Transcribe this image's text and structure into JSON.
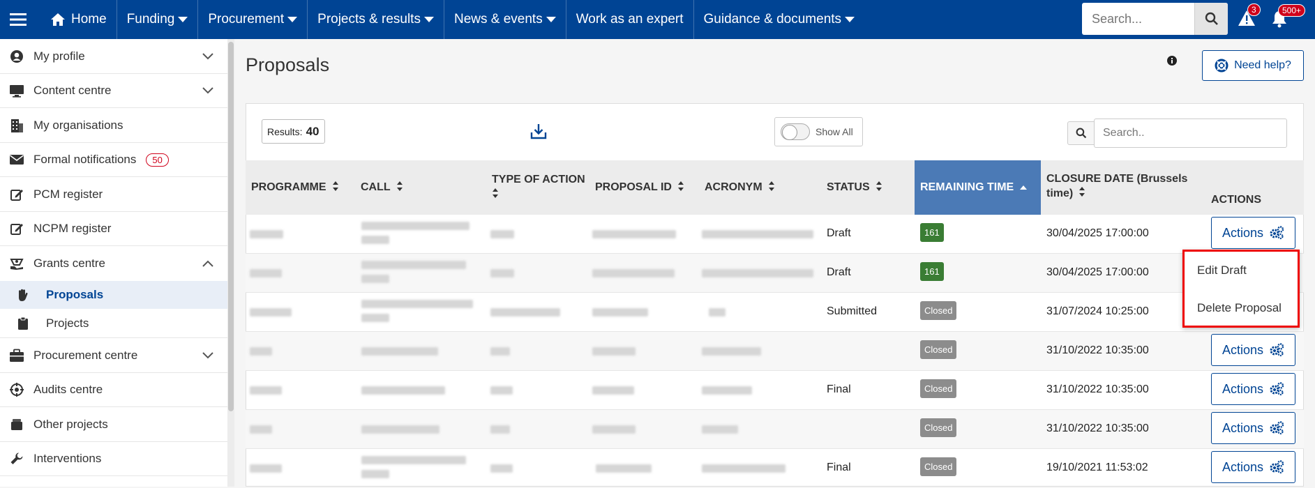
{
  "topnav": {
    "home": "Home",
    "items": [
      "Funding",
      "Procurement",
      "Projects & results",
      "News & events",
      "Work as an expert",
      "Guidance & documents"
    ],
    "search_placeholder": "Search...",
    "alert_count": "3",
    "notification_count": "500+"
  },
  "sidebar": {
    "items": [
      {
        "label": "My profile"
      },
      {
        "label": "Content centre"
      },
      {
        "label": "My organisations"
      },
      {
        "label": "Formal notifications",
        "badge": "50"
      },
      {
        "label": "PCM register"
      },
      {
        "label": "NCPM register"
      },
      {
        "label": "Grants centre"
      },
      {
        "label": "Proposals"
      },
      {
        "label": "Projects"
      },
      {
        "label": "Procurement centre"
      },
      {
        "label": "Audits centre"
      },
      {
        "label": "Other projects"
      },
      {
        "label": "Interventions"
      }
    ]
  },
  "page": {
    "title": "Proposals",
    "help_label": "Need help?",
    "results_label": "Results:",
    "results_count": "40",
    "show_all_label": "Show All",
    "table_search_placeholder": "Search.."
  },
  "table": {
    "headers": [
      "PROGRAMME",
      "CALL",
      "TYPE OF ACTION",
      "PROPOSAL ID",
      "ACRONYM",
      "STATUS",
      "REMAINING TIME",
      "CLOSURE DATE (Brussels time)",
      "ACTIONS"
    ],
    "rows": [
      {
        "status": "Draft",
        "remaining": "161",
        "closure": "30/04/2025 17:00:00",
        "action": "Actions"
      },
      {
        "status": "Draft",
        "remaining": "161",
        "closure": "30/04/2025 17:00:00",
        "action": ""
      },
      {
        "status": "Submitted",
        "remaining": "Closed",
        "closure": "31/07/2024 10:25:00",
        "action": ""
      },
      {
        "status": "",
        "remaining": "Closed",
        "closure": "31/10/2022 10:35:00",
        "action": "Actions"
      },
      {
        "status": "Final",
        "remaining": "Closed",
        "closure": "31/10/2022 10:35:00",
        "action": "Actions"
      },
      {
        "status": "",
        "remaining": "Closed",
        "closure": "31/10/2022 10:35:00",
        "action": "Actions"
      },
      {
        "status": "Final",
        "remaining": "Closed",
        "closure": "19/10/2021 11:53:02",
        "action": "Actions"
      }
    ]
  },
  "dropdown": {
    "items": [
      "Edit Draft",
      "Delete Proposal"
    ]
  },
  "colors": {
    "brand": "#004494",
    "active_header": "#4b7ab6",
    "remaining_open": "#3a7d34",
    "remaining_closed": "#8c8c8c",
    "highlight": "#e00000"
  }
}
